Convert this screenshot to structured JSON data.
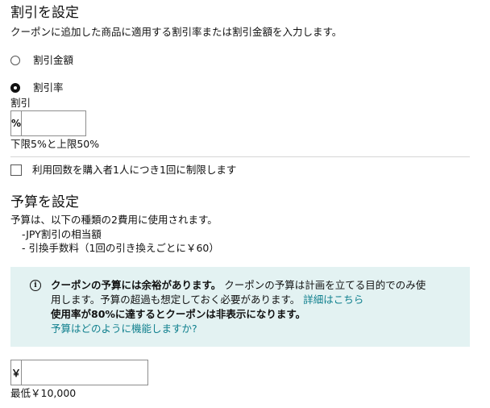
{
  "discount_section": {
    "title": "割引を設定",
    "description": "クーポンに追加した商品に適用する割引率または割引金額を入力します。",
    "options": [
      {
        "label": "割引金額",
        "selected": false
      },
      {
        "label": "割引率",
        "selected": true
      }
    ],
    "field_label": "割引",
    "unit": "%",
    "value": "",
    "hint": "下限5%と上限50%",
    "limit_checkbox_label": "利用回数を購入者1人につき1回に制限します",
    "limit_checked": false
  },
  "budget_section": {
    "title": "予算を設定",
    "description": "予算は、以下の種類の2費用に使用されます。",
    "items": [
      "-JPY割引の相当額",
      "- 引換手数料（1回の引き換えごとに￥60）"
    ],
    "alert": {
      "bold_lead": "クーポンの予算には余裕があります。",
      "text_line1": "クーポンの予算は計画を立てる目的でのみ使",
      "text_line2": "用します。予算の超過も想定しておく必要があります。",
      "details_link": "詳細はこちら",
      "bold_line": "使用率が80%に達するとクーポンは非表示になります。",
      "help_link": "予算はどのように機能しますか?"
    },
    "unit": "￥",
    "value": "",
    "hint": "最低￥10,000"
  },
  "colors": {
    "link": "#0e7f8d",
    "alert_bg": "#e3f2f2"
  }
}
